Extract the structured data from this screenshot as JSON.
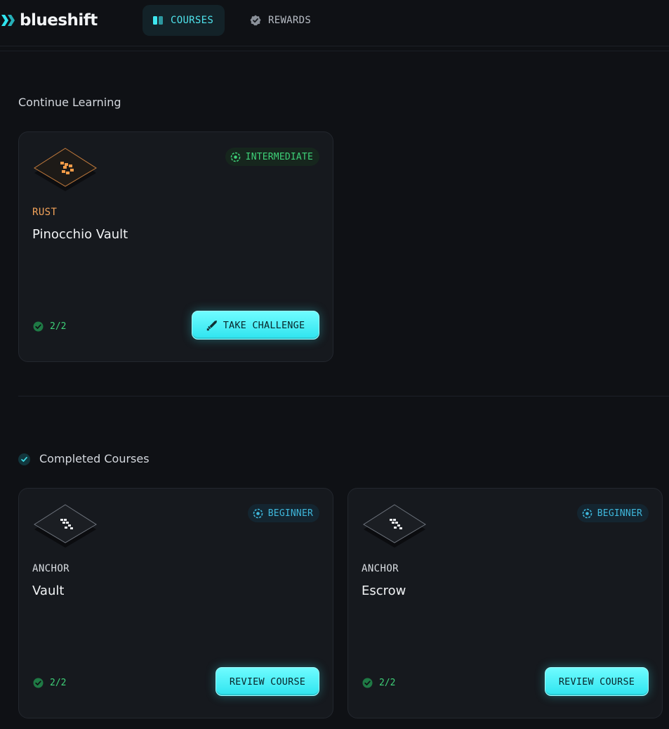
{
  "header": {
    "brand": "blueshift",
    "nav": [
      {
        "label": "COURSES",
        "icon": "book-icon",
        "active": true
      },
      {
        "label": "REWARDS",
        "icon": "badge-check-icon",
        "active": false
      }
    ]
  },
  "continue_section": {
    "title": "Continue Learning",
    "cards": [
      {
        "language": "RUST",
        "title": "Pinocchio Vault",
        "level": "INTERMEDIATE",
        "progress": "2/2",
        "cta": "TAKE CHALLENGE",
        "cta_icon": "sword-icon",
        "icon": "rust-glyph-icon"
      }
    ]
  },
  "completed_section": {
    "title": "Completed Courses",
    "cards": [
      {
        "language": "ANCHOR",
        "title": "Vault",
        "level": "BEGINNER",
        "progress": "2/2",
        "cta": "REVIEW COURSE",
        "icon": "anchor-glyph-icon"
      },
      {
        "language": "ANCHOR",
        "title": "Escrow",
        "level": "BEGINNER",
        "progress": "2/2",
        "cta": "REVIEW COURSE",
        "icon": "anchor-glyph-icon"
      }
    ]
  },
  "colors": {
    "background": "#0f1115",
    "accent_cyan": "#2fe4ef",
    "intermediate_green": "#3ed078",
    "beginner_blue": "#3fb8dc",
    "rust_orange": "#f3a35a"
  }
}
